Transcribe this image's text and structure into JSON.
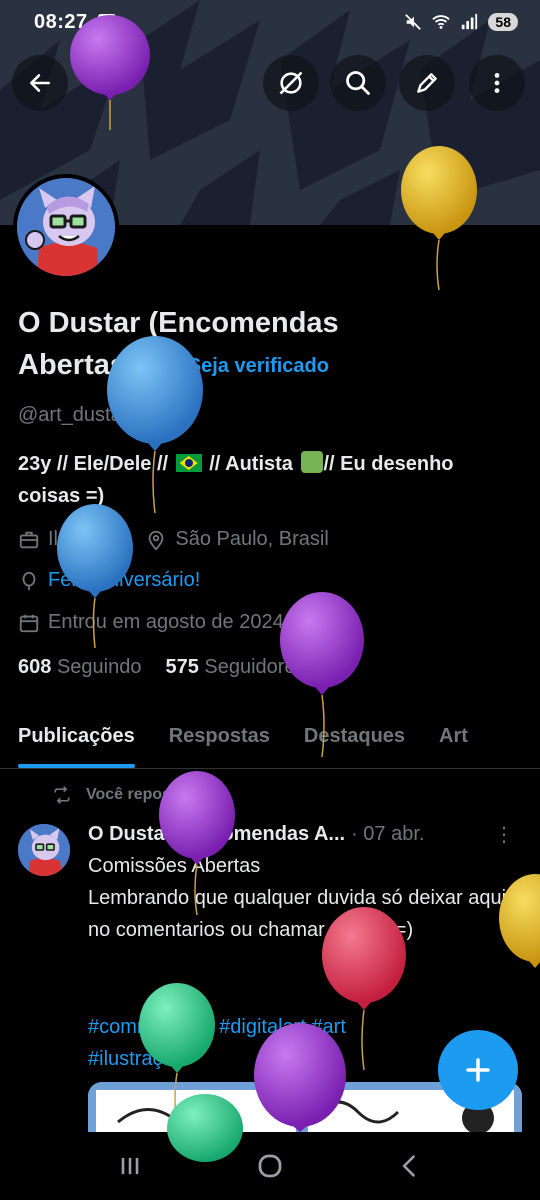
{
  "status_bar": {
    "time": "08:27",
    "battery": "58",
    "icons": [
      "screenshot-icon",
      "mute-icon",
      "wifi-icon",
      "signal-icon",
      "battery-icon"
    ]
  },
  "header": {
    "buttons": [
      "back-arrow-icon",
      "grok-icon",
      "search-icon",
      "edit-icon",
      "more-vertical-icon"
    ]
  },
  "profile": {
    "name": "O Dustar (Encomendas Abertas)",
    "verify_link": "Seja verificado",
    "handle": "@art_dustar",
    "bio_part1": "23y // Ele/Dele // ",
    "bio_part2": " // Autista ",
    "bio_part3": "// Eu desenho coisas =)",
    "profession": "Ilustrador",
    "location": "São Paulo, Brasil",
    "birthday": "Feliz Aniversário!",
    "joined": "Entrou em agosto de 2024",
    "following_count": "608",
    "following_label": "Seguindo",
    "followers_count": "575",
    "followers_label": "Seguidores"
  },
  "tabs": [
    {
      "label": "Publicações",
      "active": true
    },
    {
      "label": "Respostas",
      "active": false
    },
    {
      "label": "Destaques",
      "active": false
    },
    {
      "label": "Art",
      "active": false
    }
  ],
  "post": {
    "repost_label": "Você repostou",
    "author": "O Dustar (Encomendas A...",
    "date": "· 07 abr.",
    "more": "⋮",
    "text": "Comissões Abertas\nLembrando que qualquer duvida só deixar aqui no comentarios ou chamar na DM =)",
    "tags": "#commisonart #digitalart #art #ilustração"
  },
  "fab": {
    "icon": "plus-icon"
  },
  "nav_bar": {
    "icons": [
      "recent-apps-icon",
      "home-icon",
      "back-icon"
    ]
  },
  "colors": {
    "accent": "#1d9bf0",
    "muted": "#71767b",
    "text": "#e7e9ea",
    "balloon_purple": "#9b30d0",
    "balloon_yellow": "#e8b820",
    "balloon_blue": "#3a8fdc",
    "balloon_red": "#e03050",
    "balloon_green": "#2ec98a"
  }
}
